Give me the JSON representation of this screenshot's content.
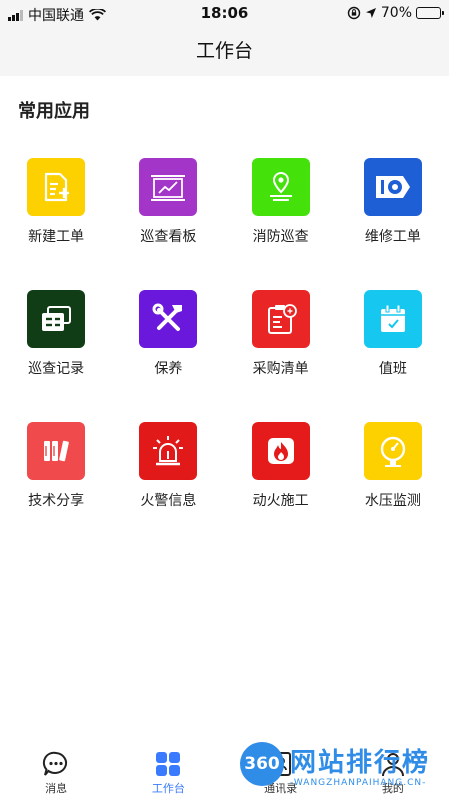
{
  "status_bar": {
    "carrier": "中国联通",
    "time": "18:06",
    "battery": "70%",
    "battery_level": 0.7
  },
  "nav": {
    "title": "工作台"
  },
  "section": {
    "title": "常用应用"
  },
  "apps": [
    {
      "label": "新建工单",
      "icon": "new-work-order-icon",
      "color": "#fdd000"
    },
    {
      "label": "巡查看板",
      "icon": "patrol-board-icon",
      "color": "#a335c8"
    },
    {
      "label": "消防巡查",
      "icon": "fire-patrol-location-icon",
      "color": "#44e20a"
    },
    {
      "label": "维修工单",
      "icon": "repair-tag-icon",
      "color": "#1f5fd6"
    },
    {
      "label": "巡查记录",
      "icon": "patrol-record-icon",
      "color": "#103c16"
    },
    {
      "label": "保养",
      "icon": "maintenance-tools-icon",
      "color": "#6a18dc"
    },
    {
      "label": "采购清单",
      "icon": "purchase-list-icon",
      "color": "#ea2525"
    },
    {
      "label": "值班",
      "icon": "duty-calendar-icon",
      "color": "#16c7ef"
    },
    {
      "label": "技术分享",
      "icon": "tech-share-books-icon",
      "color": "#f04a4c"
    },
    {
      "label": "火警信息",
      "icon": "fire-alarm-siren-icon",
      "color": "#e11919"
    },
    {
      "label": "动火施工",
      "icon": "hot-work-flame-icon",
      "color": "#e51b1b"
    },
    {
      "label": "水压监测",
      "icon": "water-pressure-gauge-icon",
      "color": "#fdd000"
    }
  ],
  "tabs": [
    {
      "label": "消息",
      "icon": "message-bubble-icon",
      "active": false
    },
    {
      "label": "工作台",
      "icon": "workbench-grid-icon",
      "active": true
    },
    {
      "label": "通讯录",
      "icon": "contacts-icon",
      "active": false
    },
    {
      "label": "我的",
      "icon": "user-icon",
      "active": false
    }
  ],
  "watermark": {
    "logo": "360",
    "text": "网站排行榜",
    "sub": "-WANGZHANPAIHANG.CN-"
  },
  "colors": {
    "accent": "#3a7afe",
    "watermark": "#2f8de8"
  }
}
